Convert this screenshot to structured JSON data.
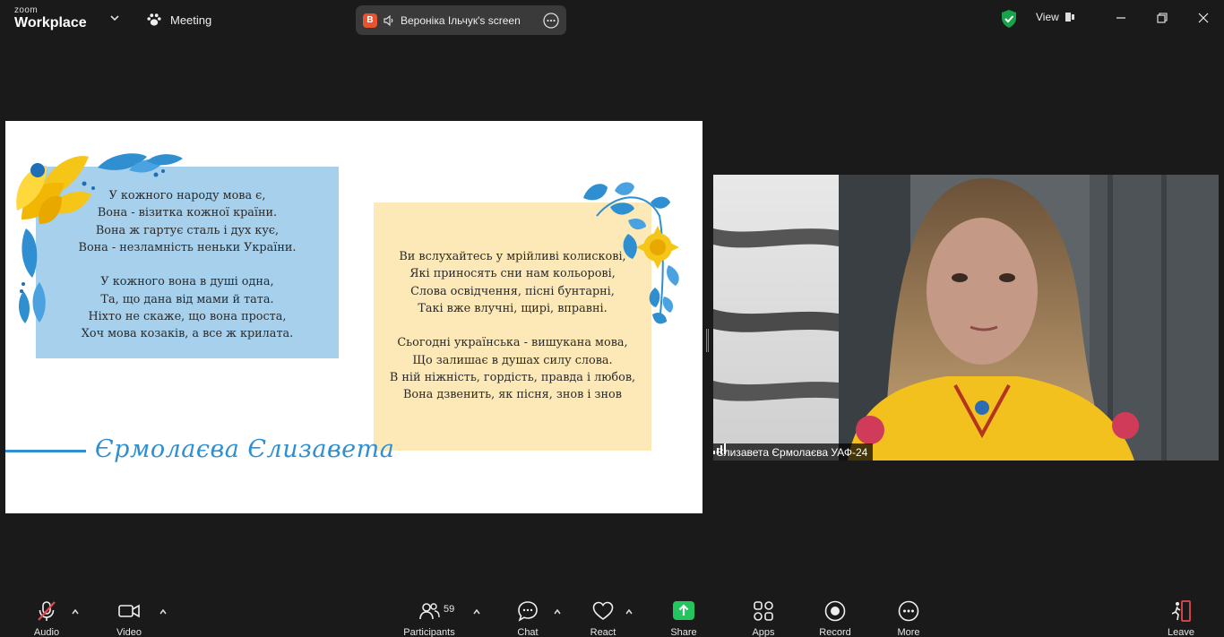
{
  "app": {
    "brand_top": "zoom",
    "brand_name": "Workplace",
    "meeting_label": "Meeting",
    "share_initial": "В",
    "share_label": "Вероніка Ільчук's screen",
    "view_label": "View"
  },
  "slide": {
    "poem_left": [
      "У кожного народу мова є,",
      "Вона - візитка кожної країни.",
      "Вона ж гартує сталь і дух кує,",
      "Вона - незламність неньки України.",
      "",
      "У кожного вона в душі одна,",
      "Та, що дана від мами й тата.",
      "Ніхто не скаже, що вона проста,",
      "Хоч мова козаків, а все ж крилата."
    ],
    "poem_right": [
      "Ви вслухайтесь у мрійливі колискові,",
      "Які приносять сни нам кольорові,",
      "Слова освідчення, пісні бунтарні,",
      "Такі вже влучні, щирі, вправні.",
      "",
      "Сьогодні українська - вишукана мова,",
      "Що залишає в душах силу слова.",
      "В ній ніжність, гордість, правда і любов,",
      "Вона дзвенить, як пісня, знов і знов"
    ],
    "signature": "Єрмолаєва Єлизавета"
  },
  "video": {
    "participant_name": "Єлизавета Єрмолаєва УАФ-24"
  },
  "toolbar": {
    "audio": "Audio",
    "video": "Video",
    "participants": "Participants",
    "participants_count": "59",
    "chat": "Chat",
    "react": "React",
    "share": "Share",
    "apps": "Apps",
    "record": "Record",
    "more": "More",
    "leave": "Leave"
  },
  "colors": {
    "share_green": "#22c55e",
    "shield_green": "#16a34a",
    "mute_red": "#e5484d",
    "leave_red": "#e5484d",
    "slide_blue": "#2f8fd0",
    "card_blue": "#a7d0ec",
    "card_yellow": "#fde9b8"
  }
}
